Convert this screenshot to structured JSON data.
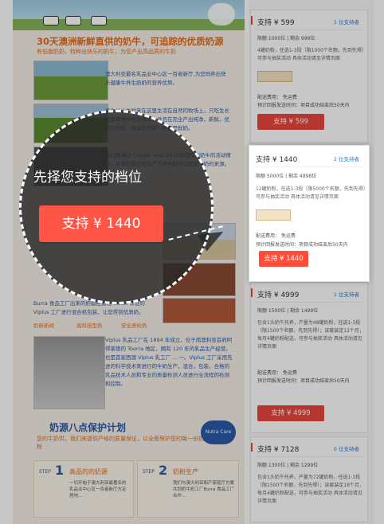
{
  "left": {
    "section1_title": "30天澳洲新鲜直供的奶牛，可追踪的优质奶源",
    "section1_sub": "有低脂奶奶，特种出快乐的奶牛，为您产出高品质的牛奶",
    "para1": "澳大利亚最名乳品业中心区一百者新厅,为您饲养出快乐健康牛养生奶奶的营养优势。",
    "para2": "奶牛从小牛时来在这里生活在自然的牧场上，只吃生长在富草场中的生青草，并且在完全产出纯净，新鲜，优质的牛奶，保证您的每一杯都是鲜奶。",
    "para3": "我们来通过 Google map 24 小时追踪到奶牛的活动情况，在澳奶最好在生产下的牛奶可以找到牛奶的来源。",
    "badge_text": "24H",
    "para4": "Burra 食品工厂出来的奶都经通过 CNCA 认证的 Viplus 工厂进行混合机包装，让您得到优质奶。",
    "links": [
      "奶粉新闻",
      "高科技型奶",
      "安全质检奶"
    ],
    "para5": "Viplus 乳品工厂在 1894 年成立，位于南澳利亚首府阿得莱德的 Toorra 地区，拥有 120 年的乳品生产经营。也是首家西澳 Viplus 乳工厂 ... 一。Viplus 工厂采用先进的科学技术来进行的牛奶生产，混合，包装，合格的乳品技术人员和专业的质量检测人员进行全流程的检测和控制。",
    "section2_title": "奶源八点保护计划",
    "section2_sub": "您的牛奶供，我们来提供严格的质量保证，以全面保护您的每一份奶粉",
    "nutra_logo": "Nutra Care",
    "step1_label": "STEP",
    "step1_num": "1",
    "step1_title": "高品的的奶源",
    "step1_text": "一切开始于澳大利亚最著名的乳品业中心区一百者新厅方定居地...",
    "step2_label": "STEP",
    "step2_num": "2",
    "step2_title": "奶粉生产",
    "step2_text": "我们与澳大利亚和产家庭厅方案共同奶牛奶工厂Burra 食品工厂合作..."
  },
  "cards": [
    {
      "price": "支持 ¥ 599",
      "supporters": "1 位支持者",
      "meta": "限额 1000位 | 剩余 999位",
      "desc": "4罐奶粉，任选1-3段（限1000个名额，先到先得）可参与抽奖活动 具体活动请见详情页面",
      "fee": "配送费用： 免运费",
      "send": "预计回报发送时间：项目成功结束后50天内",
      "button": "支持 ¥ 599"
    },
    {
      "price": "支持 ¥ 4999",
      "supporters": "1 位支持者",
      "meta": "限额 1500位 | 剩余 1499位",
      "desc": "包含1头奶牛托养，产量为48罐奶粉，任选1-3段（限1500个名额，先到先得）；该套装定12个月，每月4罐奶粉配送，可参与抽奖活动 具体活动请见详情页面",
      "fee": "配送费用： 免运费",
      "send": "预计回报发送时间：项目成功结束后50天内",
      "button": "支持 ¥ 4999"
    },
    {
      "price": "支持 ¥ 7128",
      "supporters": "0 位支持者",
      "meta": "限额 1300位 | 剩余 1299位",
      "desc": "包含1头奶牛托养，产量为72罐奶粉，任选1-3段（限1500个名额，先到先得）；该套装定18个月，每月4罐奶粉配送，可参与抽奖活动 具体活动请见详情页面",
      "fee": "",
      "send": "",
      "button": ""
    }
  ],
  "highlight": {
    "price": "支持 ¥ 1440",
    "supporters": "2 位支持者",
    "meta": "限额 5000位 | 剩余 4998位",
    "desc": "12罐奶粉，任选1-3段（限5000个名额，先到先得）可参与抽奖活动 具体活动请见详情页面",
    "fee": "配送费用： 免运费",
    "send": "预计回报发送时间：项目成功结束后50天内",
    "button": "支持 ¥ 1440"
  },
  "tooltip": {
    "text": "先择您支持的档位",
    "button": "支持 ¥ 1440"
  },
  "colors": {
    "accent_orange": "#e66b19",
    "button_red": "#e8473d",
    "link_blue": "#2c7bd6"
  }
}
